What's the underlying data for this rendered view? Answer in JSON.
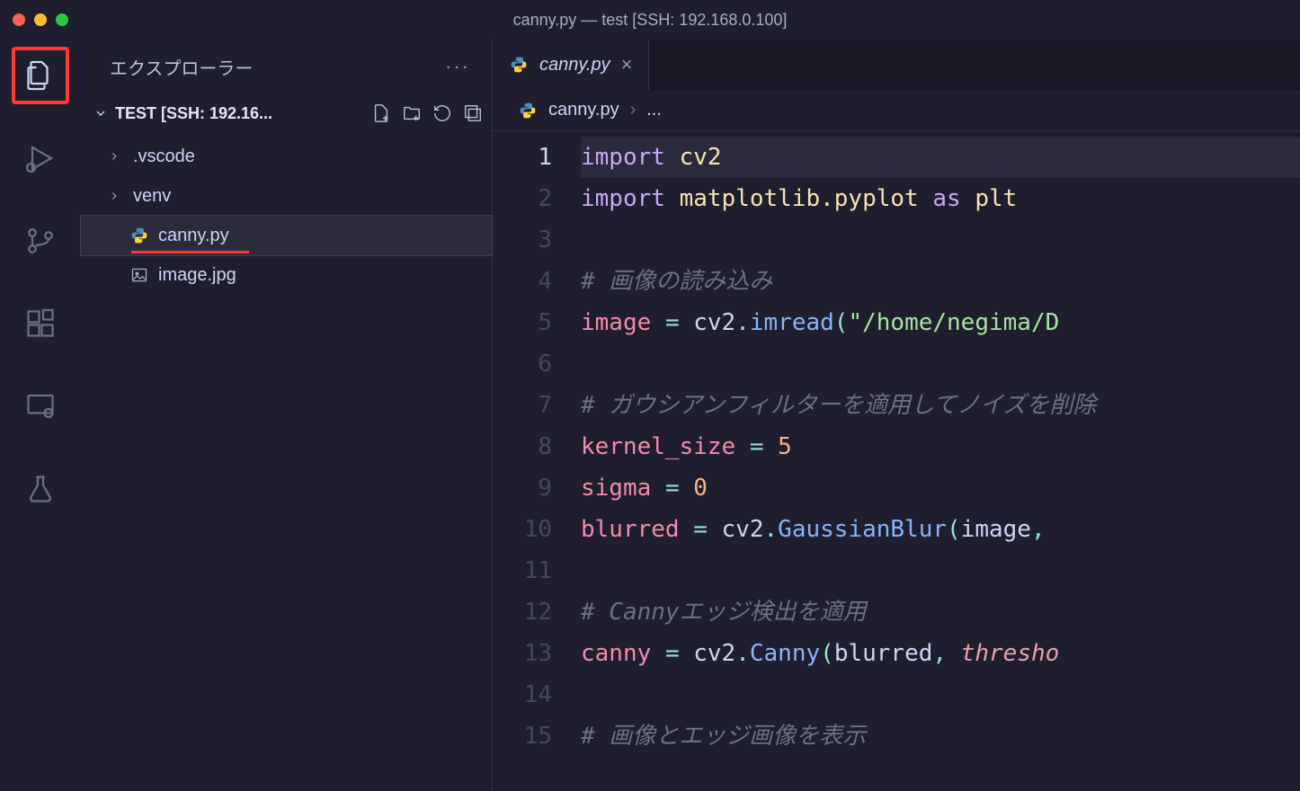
{
  "window": {
    "title": "canny.py — test [SSH: 192.168.0.100]"
  },
  "sidebar": {
    "title": "エクスプローラー",
    "folder_label": "TEST [SSH: 192.16...",
    "items": [
      {
        "type": "folder",
        "label": ".vscode"
      },
      {
        "type": "folder",
        "label": "venv"
      },
      {
        "type": "file",
        "label": "canny.py",
        "icon": "python",
        "selected": true
      },
      {
        "type": "file",
        "label": "image.jpg",
        "icon": "image"
      }
    ]
  },
  "tabs": [
    {
      "label": "canny.py",
      "icon": "python",
      "active": true
    }
  ],
  "breadcrumb": {
    "file": "canny.py",
    "suffix": "..."
  },
  "code": {
    "line_count": 15,
    "active_line": 1,
    "lines": [
      [
        [
          "kw",
          "import"
        ],
        [
          "sp",
          " "
        ],
        [
          "mod",
          "cv2"
        ]
      ],
      [
        [
          "kw",
          "import"
        ],
        [
          "sp",
          " "
        ],
        [
          "mod",
          "matplotlib.pyplot"
        ],
        [
          "sp",
          " "
        ],
        [
          "kw",
          "as"
        ],
        [
          "sp",
          " "
        ],
        [
          "mod",
          "plt"
        ]
      ],
      [],
      [
        [
          "comment",
          "# 画像の読み込み"
        ]
      ],
      [
        [
          "var",
          "image"
        ],
        [
          "sp",
          " "
        ],
        [
          "op",
          "="
        ],
        [
          "sp",
          " "
        ],
        [
          "id",
          "cv2"
        ],
        [
          "op",
          "."
        ],
        [
          "fn",
          "imread"
        ],
        [
          "op",
          "("
        ],
        [
          "str",
          "\"/home/negima/D"
        ]
      ],
      [],
      [
        [
          "comment",
          "# ガウシアンフィルターを適用してノイズを削除"
        ]
      ],
      [
        [
          "var",
          "kernel_size"
        ],
        [
          "sp",
          " "
        ],
        [
          "op",
          "="
        ],
        [
          "sp",
          " "
        ],
        [
          "num",
          "5"
        ]
      ],
      [
        [
          "var",
          "sigma"
        ],
        [
          "sp",
          " "
        ],
        [
          "op",
          "="
        ],
        [
          "sp",
          " "
        ],
        [
          "num",
          "0"
        ]
      ],
      [
        [
          "var",
          "blurred"
        ],
        [
          "sp",
          " "
        ],
        [
          "op",
          "="
        ],
        [
          "sp",
          " "
        ],
        [
          "id",
          "cv2"
        ],
        [
          "op",
          "."
        ],
        [
          "fn",
          "GaussianBlur"
        ],
        [
          "op",
          "("
        ],
        [
          "id",
          "image"
        ],
        [
          "op",
          ","
        ],
        [
          "sp",
          " "
        ]
      ],
      [],
      [
        [
          "comment",
          "# Cannyエッジ検出を適用"
        ]
      ],
      [
        [
          "var",
          "canny"
        ],
        [
          "sp",
          " "
        ],
        [
          "op",
          "="
        ],
        [
          "sp",
          " "
        ],
        [
          "id",
          "cv2"
        ],
        [
          "op",
          "."
        ],
        [
          "fn",
          "Canny"
        ],
        [
          "op",
          "("
        ],
        [
          "id",
          "blurred"
        ],
        [
          "op",
          ","
        ],
        [
          "sp",
          " "
        ],
        [
          "param",
          "thresho"
        ]
      ],
      [],
      [
        [
          "comment",
          "# 画像とエッジ画像を表示"
        ]
      ]
    ]
  }
}
